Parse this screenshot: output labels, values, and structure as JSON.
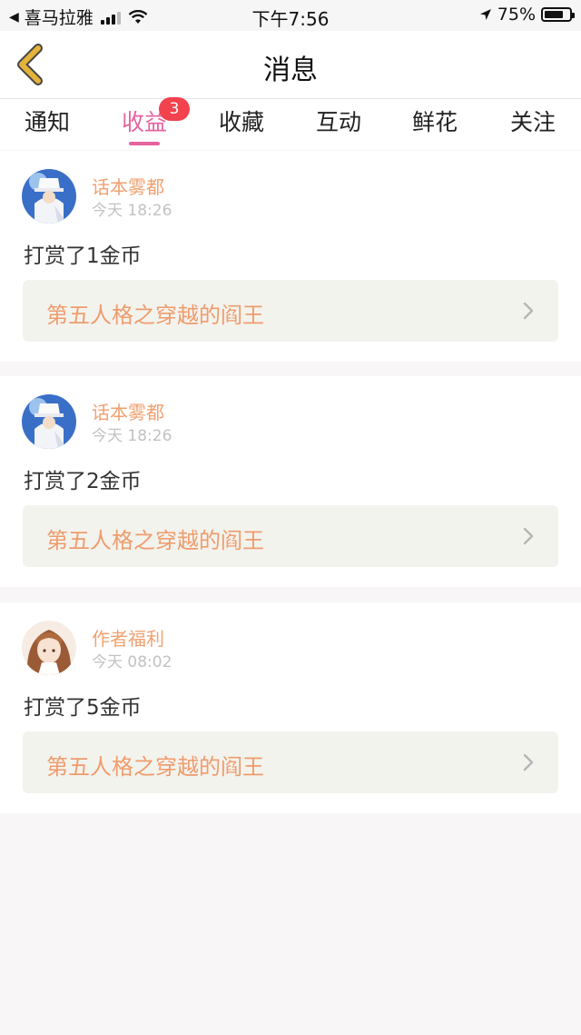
{
  "status_bar": {
    "back_app": "喜马拉雅",
    "time": "下午7:56",
    "battery": "75%",
    "battery_level": 0.75
  },
  "nav": {
    "title": "消息"
  },
  "tabs": [
    {
      "label": "通知"
    },
    {
      "label": "收益",
      "badge": "3"
    },
    {
      "label": "收藏"
    },
    {
      "label": "互动"
    },
    {
      "label": "鲜花"
    },
    {
      "label": "关注"
    }
  ],
  "messages": [
    {
      "user": "话本雾都",
      "time": "今天 18:26",
      "text": "打赏了1金币",
      "book": "第五人格之穿越的阎王",
      "avatar": "blue-white-avatar"
    },
    {
      "user": "话本雾都",
      "time": "今天 18:26",
      "text": "打赏了2金币",
      "book": "第五人格之穿越的阎王",
      "avatar": "blue-white-avatar"
    },
    {
      "user": "作者福利",
      "time": "今天 08:02",
      "text": "打赏了5金币",
      "book": "第五人格之穿越的阎王",
      "avatar": "brown-hair-avatar"
    }
  ],
  "colors": {
    "accent": "#e5639f",
    "name": "#f0a170",
    "book": "#ef9c6c",
    "badge": "#f2424d",
    "back_arrow": "#e3b33a"
  }
}
